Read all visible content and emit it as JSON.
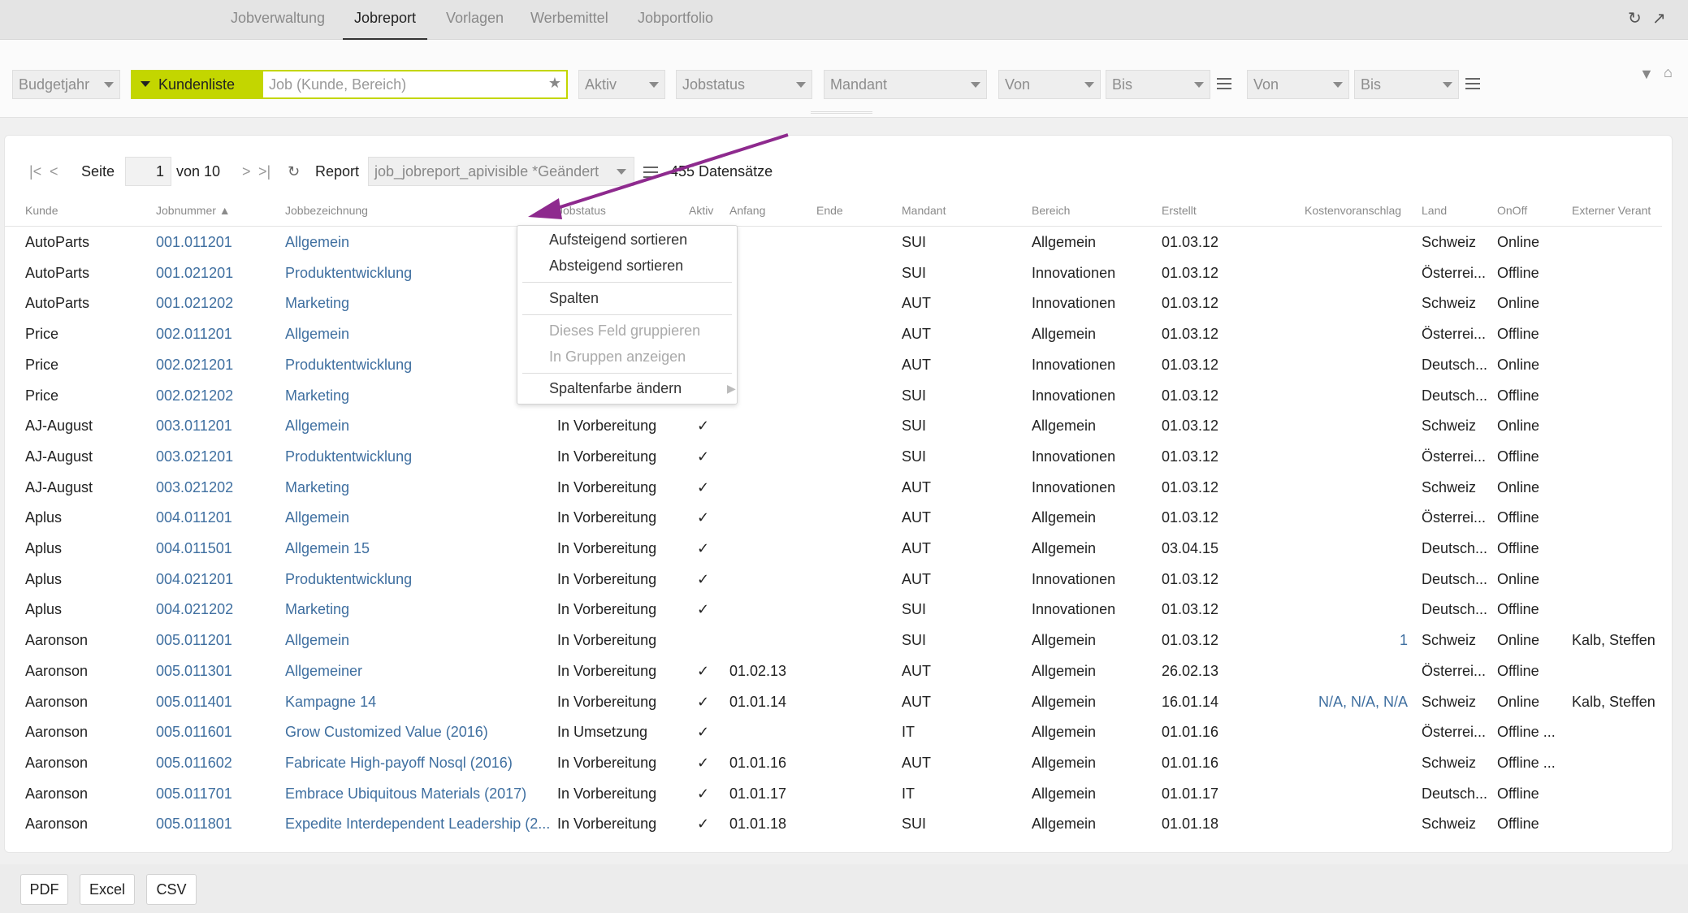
{
  "nav": {
    "tabs": [
      {
        "label": "Jobverwaltung"
      },
      {
        "label": "Jobreport"
      },
      {
        "label": "Vorlagen"
      },
      {
        "label": "Werbemittel"
      },
      {
        "label": "Jobportfolio"
      }
    ],
    "active": "Jobreport"
  },
  "filters": {
    "budgetjahr": "Budgetjahr",
    "kundenliste": "Kundenliste",
    "job_placeholder": "Job (Kunde, Bereich)",
    "aktiv": "Aktiv",
    "jobstatus": "Jobstatus",
    "mandant": "Mandant",
    "von1": "Von",
    "bis1": "Bis",
    "von2": "Von",
    "bis2": "Bis"
  },
  "pager": {
    "seite_label": "Seite",
    "page": "1",
    "von_label": "von 10",
    "report_label": "Report",
    "report_value": "job_jobreport_apivisible *Geändert",
    "count_label": "455 Datensätze"
  },
  "columns": [
    "Kunde",
    "Jobnummer ▲",
    "Jobbezeichnung",
    "Jobstatus",
    "Aktiv",
    "Anfang",
    "Ende",
    "Mandant",
    "Bereich",
    "Erstellt",
    "Kostenvoranschlag",
    "Land",
    "OnOff",
    "Externer Verant"
  ],
  "rows": [
    {
      "kunde": "AutoParts",
      "nr": "001.011201",
      "bez": "Allgemein",
      "status": "",
      "aktiv": "",
      "anfang": "",
      "mandant": "SUI",
      "bereich": "Allgemein",
      "erstellt": "01.03.12",
      "kv": "",
      "land": "Schweiz",
      "onoff": "Online",
      "ext": ""
    },
    {
      "kunde": "AutoParts",
      "nr": "001.021201",
      "bez": "Produktentwicklung",
      "status": "",
      "aktiv": "",
      "anfang": "",
      "mandant": "SUI",
      "bereich": "Innovationen",
      "erstellt": "01.03.12",
      "kv": "",
      "land": "Österrei...",
      "onoff": "Offline",
      "ext": ""
    },
    {
      "kunde": "AutoParts",
      "nr": "001.021202",
      "bez": "Marketing",
      "status": "",
      "aktiv": "",
      "anfang": "",
      "mandant": "AUT",
      "bereich": "Innovationen",
      "erstellt": "01.03.12",
      "kv": "",
      "land": "Schweiz",
      "onoff": "Online",
      "ext": ""
    },
    {
      "kunde": "Price",
      "nr": "002.011201",
      "bez": "Allgemein",
      "status": "",
      "aktiv": "",
      "anfang": "",
      "mandant": "AUT",
      "bereich": "Allgemein",
      "erstellt": "01.03.12",
      "kv": "",
      "land": "Österrei...",
      "onoff": "Offline",
      "ext": ""
    },
    {
      "kunde": "Price",
      "nr": "002.021201",
      "bez": "Produktentwicklung",
      "status": "",
      "aktiv": "",
      "anfang": "",
      "mandant": "AUT",
      "bereich": "Innovationen",
      "erstellt": "01.03.12",
      "kv": "",
      "land": "Deutsch...",
      "onoff": "Online",
      "ext": ""
    },
    {
      "kunde": "Price",
      "nr": "002.021202",
      "bez": "Marketing",
      "status": "",
      "aktiv": "",
      "anfang": "",
      "mandant": "SUI",
      "bereich": "Innovationen",
      "erstellt": "01.03.12",
      "kv": "",
      "land": "Deutsch...",
      "onoff": "Offline",
      "ext": ""
    },
    {
      "kunde": "AJ-August",
      "nr": "003.011201",
      "bez": "Allgemein",
      "status": "In Vorbereitung",
      "aktiv": "✓",
      "anfang": "",
      "mandant": "SUI",
      "bereich": "Allgemein",
      "erstellt": "01.03.12",
      "kv": "",
      "land": "Schweiz",
      "onoff": "Online",
      "ext": ""
    },
    {
      "kunde": "AJ-August",
      "nr": "003.021201",
      "bez": "Produktentwicklung",
      "status": "In Vorbereitung",
      "aktiv": "✓",
      "anfang": "",
      "mandant": "SUI",
      "bereich": "Innovationen",
      "erstellt": "01.03.12",
      "kv": "",
      "land": "Österrei...",
      "onoff": "Offline",
      "ext": ""
    },
    {
      "kunde": "AJ-August",
      "nr": "003.021202",
      "bez": "Marketing",
      "status": "In Vorbereitung",
      "aktiv": "✓",
      "anfang": "",
      "mandant": "AUT",
      "bereich": "Innovationen",
      "erstellt": "01.03.12",
      "kv": "",
      "land": "Schweiz",
      "onoff": "Online",
      "ext": ""
    },
    {
      "kunde": "Aplus",
      "nr": "004.011201",
      "bez": "Allgemein",
      "status": "In Vorbereitung",
      "aktiv": "✓",
      "anfang": "",
      "mandant": "AUT",
      "bereich": "Allgemein",
      "erstellt": "01.03.12",
      "kv": "",
      "land": "Österrei...",
      "onoff": "Offline",
      "ext": ""
    },
    {
      "kunde": "Aplus",
      "nr": "004.011501",
      "bez": "Allgemein 15",
      "status": "In Vorbereitung",
      "aktiv": "✓",
      "anfang": "",
      "mandant": "AUT",
      "bereich": "Allgemein",
      "erstellt": "03.04.15",
      "kv": "",
      "land": "Deutsch...",
      "onoff": "Offline",
      "ext": ""
    },
    {
      "kunde": "Aplus",
      "nr": "004.021201",
      "bez": "Produktentwicklung",
      "status": "In Vorbereitung",
      "aktiv": "✓",
      "anfang": "",
      "mandant": "AUT",
      "bereich": "Innovationen",
      "erstellt": "01.03.12",
      "kv": "",
      "land": "Deutsch...",
      "onoff": "Online",
      "ext": ""
    },
    {
      "kunde": "Aplus",
      "nr": "004.021202",
      "bez": "Marketing",
      "status": "In Vorbereitung",
      "aktiv": "✓",
      "anfang": "",
      "mandant": "SUI",
      "bereich": "Innovationen",
      "erstellt": "01.03.12",
      "kv": "",
      "land": "Deutsch...",
      "onoff": "Offline",
      "ext": ""
    },
    {
      "kunde": "Aaronson",
      "nr": "005.011201",
      "bez": "Allgemein",
      "status": "In Vorbereitung",
      "aktiv": "",
      "anfang": "",
      "mandant": "SUI",
      "bereich": "Allgemein",
      "erstellt": "01.03.12",
      "kv": "1",
      "land": "Schweiz",
      "onoff": "Online",
      "ext": "Kalb, Steffen"
    },
    {
      "kunde": "Aaronson",
      "nr": "005.011301",
      "bez": "Allgemeiner",
      "status": "In Vorbereitung",
      "aktiv": "✓",
      "anfang": "01.02.13",
      "mandant": "AUT",
      "bereich": "Allgemein",
      "erstellt": "26.02.13",
      "kv": "",
      "land": "Österrei...",
      "onoff": "Offline",
      "ext": ""
    },
    {
      "kunde": "Aaronson",
      "nr": "005.011401",
      "bez": "Kampagne 14",
      "status": "In Vorbereitung",
      "aktiv": "✓",
      "anfang": "01.01.14",
      "mandant": "AUT",
      "bereich": "Allgemein",
      "erstellt": "16.01.14",
      "kv": "N/A, N/A, N/A",
      "land": "Schweiz",
      "onoff": "Online",
      "ext": "Kalb, Steffen"
    },
    {
      "kunde": "Aaronson",
      "nr": "005.011601",
      "bez": "Grow Customized Value (2016)",
      "status": "In Umsetzung",
      "aktiv": "✓",
      "anfang": "",
      "mandant": "IT",
      "bereich": "Allgemein",
      "erstellt": "01.01.16",
      "kv": "",
      "land": "Österrei...",
      "onoff": "Offline ...",
      "ext": ""
    },
    {
      "kunde": "Aaronson",
      "nr": "005.011602",
      "bez": "Fabricate High-payoff Nosql (2016)",
      "status": "In Vorbereitung",
      "aktiv": "✓",
      "anfang": "01.01.16",
      "mandant": "AUT",
      "bereich": "Allgemein",
      "erstellt": "01.01.16",
      "kv": "",
      "land": "Schweiz",
      "onoff": "Offline ...",
      "ext": ""
    },
    {
      "kunde": "Aaronson",
      "nr": "005.011701",
      "bez": "Embrace Ubiquitous Materials (2017)",
      "status": "In Vorbereitung",
      "aktiv": "✓",
      "anfang": "01.01.17",
      "mandant": "IT",
      "bereich": "Allgemein",
      "erstellt": "01.01.17",
      "kv": "",
      "land": "Deutsch...",
      "onoff": "Offline",
      "ext": ""
    },
    {
      "kunde": "Aaronson",
      "nr": "005.011801",
      "bez": "Expedite Interdependent Leadership (2...",
      "status": "In Vorbereitung",
      "aktiv": "✓",
      "anfang": "01.01.18",
      "mandant": "SUI",
      "bereich": "Allgemein",
      "erstellt": "01.01.18",
      "kv": "",
      "land": "Schweiz",
      "onoff": "Offline",
      "ext": ""
    }
  ],
  "menu": {
    "asc": "Aufsteigend sortieren",
    "desc": "Absteigend sortieren",
    "spalten": "Spalten",
    "group": "Dieses Feld gruppieren",
    "ingroups": "In Gruppen anzeigen",
    "color": "Spaltenfarbe ändern"
  },
  "export": {
    "pdf": "PDF",
    "excel": "Excel",
    "csv": "CSV"
  },
  "colors": {
    "accent": "#c3d600",
    "link": "#3f6fa0",
    "annotation": "#8e2a8e"
  }
}
